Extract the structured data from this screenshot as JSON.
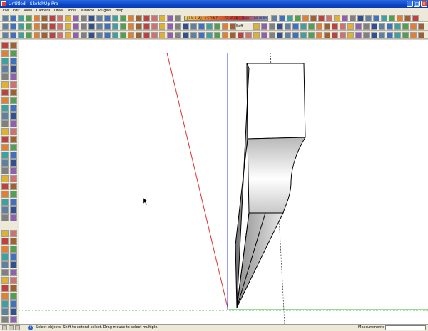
{
  "window": {
    "title": "Untitled - SketchUp Pro",
    "minimize": "_",
    "maximize": "□",
    "close": "×"
  },
  "menu": [
    "File",
    "Edit",
    "View",
    "Camera",
    "Draw",
    "Tools",
    "Window",
    "Plugins",
    "Help"
  ],
  "shadow_ribbon": {
    "months": "J F M A M J J A S O N D",
    "time_start": "07:50 AM",
    "noon": "Noon",
    "time_end": "04:48 PM"
  },
  "toolbar2": {
    "soft_label": "Soft"
  },
  "status": {
    "tip": "Select objects. Shift to extend select. Drag mouse to select multiple.",
    "measurements_label": "Measurements"
  },
  "colors": {
    "red_axis": "#e03030",
    "green_axis": "#30b030",
    "blue_axis": "#3040e0",
    "model_top": "#ffffff",
    "model_edge": "#000000"
  }
}
